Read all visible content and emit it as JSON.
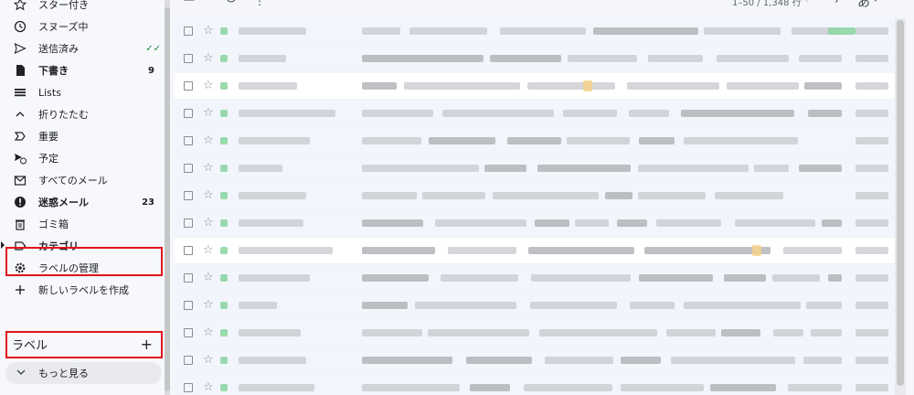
{
  "sidebar": {
    "items": [
      {
        "name": "starred",
        "label": "スター付き",
        "icon": "star-icon",
        "bold": false,
        "count": ""
      },
      {
        "name": "snoozed",
        "label": "スヌーズ中",
        "icon": "clock-icon",
        "bold": false,
        "count": ""
      },
      {
        "name": "sent",
        "label": "送信済み",
        "icon": "send-icon",
        "bold": false,
        "count": "",
        "check": "✓✓"
      },
      {
        "name": "drafts",
        "label": "下書き",
        "icon": "draft-icon",
        "bold": true,
        "count": "9"
      },
      {
        "name": "lists",
        "label": "Lists",
        "icon": "list-icon",
        "bold": false,
        "count": ""
      },
      {
        "name": "collapse",
        "label": "折りたたむ",
        "icon": "chevron-up-icon",
        "bold": false,
        "count": ""
      },
      {
        "name": "important",
        "label": "重要",
        "icon": "important-icon",
        "bold": false,
        "count": ""
      },
      {
        "name": "scheduled",
        "label": "予定",
        "icon": "scheduled-send-icon",
        "bold": false,
        "count": ""
      },
      {
        "name": "all-mail",
        "label": "すべてのメール",
        "icon": "all-mail-icon",
        "bold": false,
        "count": ""
      },
      {
        "name": "spam",
        "label": "迷惑メール",
        "icon": "spam-icon",
        "bold": true,
        "count": "23"
      },
      {
        "name": "trash",
        "label": "ゴミ箱",
        "icon": "trash-icon",
        "bold": false,
        "count": ""
      },
      {
        "name": "categories",
        "label": "カテゴリ",
        "icon": "label-icon",
        "bold": true,
        "count": ""
      },
      {
        "name": "manage-labels",
        "label": "ラベルの管理",
        "icon": "gear-icon",
        "bold": false,
        "count": ""
      },
      {
        "name": "create-label",
        "label": "新しいラベルを作成",
        "icon": "plus-icon",
        "bold": false,
        "count": ""
      }
    ],
    "labels_title": "ラベル",
    "labels_add": "+",
    "more_label": "もっと見る"
  },
  "toolbar": {
    "pagination": "1–50 / 1,348 行",
    "input_tool": "あ"
  },
  "colors": {
    "highlight": "#e1141c",
    "sidebar_bg": "#f6f8fc",
    "read_row": "#f2f6fc",
    "unread_row": "#ffffff"
  },
  "email_rows": [
    {
      "unread": false
    },
    {
      "unread": false
    },
    {
      "unread": true
    },
    {
      "unread": false
    },
    {
      "unread": false
    },
    {
      "unread": false
    },
    {
      "unread": false
    },
    {
      "unread": false
    },
    {
      "unread": true
    },
    {
      "unread": false
    },
    {
      "unread": false
    },
    {
      "unread": false
    },
    {
      "unread": false
    },
    {
      "unread": false
    }
  ]
}
